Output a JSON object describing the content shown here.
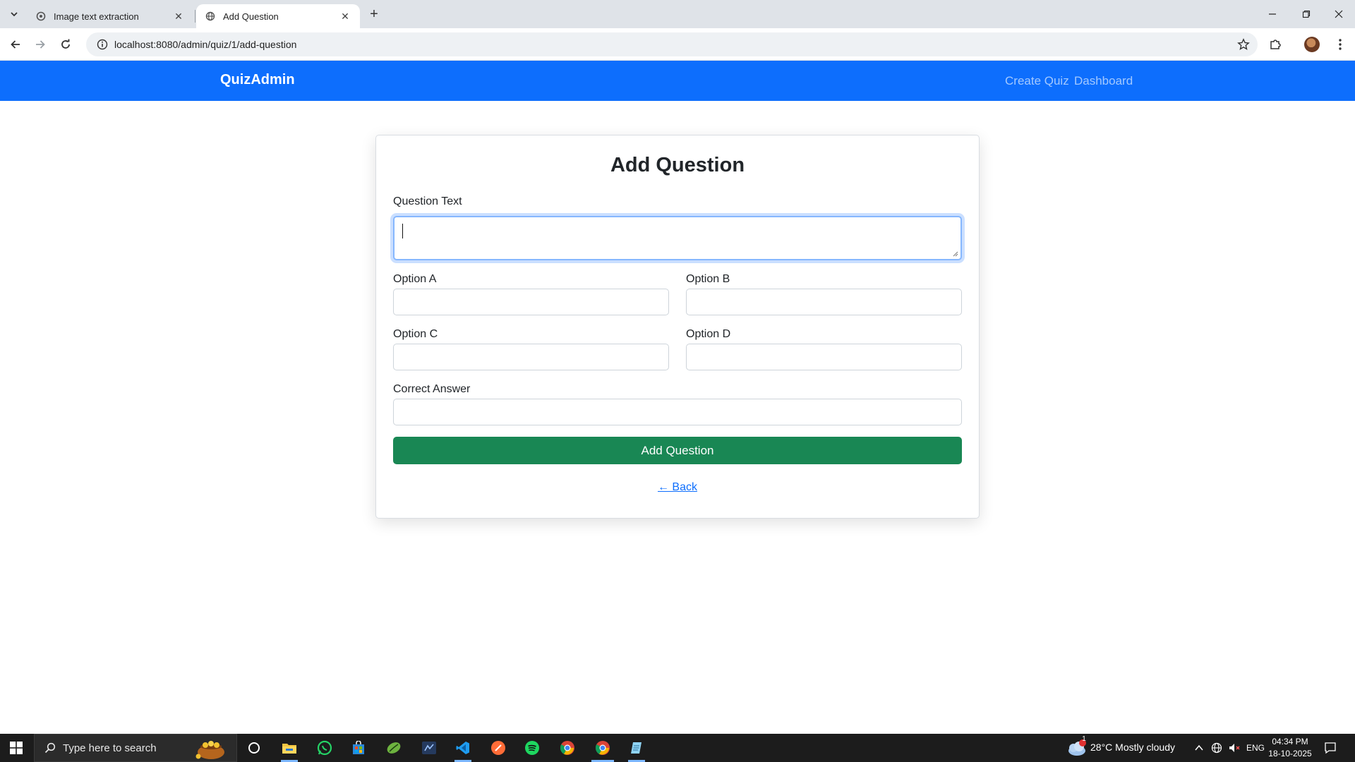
{
  "browser": {
    "tabs": [
      {
        "title": "Image text extraction",
        "active": false
      },
      {
        "title": "Add Question",
        "active": true
      }
    ],
    "url": "localhost:8080/admin/quiz/1/add-question"
  },
  "navbar": {
    "brand": "QuizAdmin",
    "links": [
      "Create Quiz",
      "Dashboard"
    ]
  },
  "form": {
    "title": "Add Question",
    "question_label": "Question Text",
    "question_value": "",
    "option_a_label": "Option A",
    "option_b_label": "Option B",
    "option_c_label": "Option C",
    "option_d_label": "Option D",
    "correct_answer_label": "Correct Answer",
    "submit_label": "Add Question",
    "back_label": "← Back"
  },
  "taskbar": {
    "search_placeholder": "Type here to search",
    "weather": "28°C  Mostly cloudy",
    "weather_badge": "1",
    "language": "ENG",
    "time": "04:34 PM",
    "date": "18-10-2025"
  },
  "colors": {
    "navbar": "#0d6efd",
    "submit": "#198754",
    "link": "#0d6efd"
  }
}
